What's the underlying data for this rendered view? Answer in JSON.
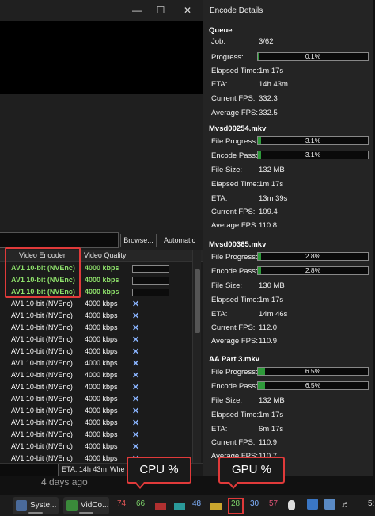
{
  "window": {
    "minimize_glyph": "—",
    "maximize_glyph": "☐",
    "close_glyph": "✕"
  },
  "toolbar": {
    "browse_label": "Browse...",
    "automatic_label": "Automatic"
  },
  "table": {
    "headers": {
      "encoder": "Video Encoder",
      "quality": "Video Quality"
    },
    "rows": [
      {
        "encoder": "AV1 10-bit (NVEnc)",
        "quality": "4000 kbps",
        "state": "active"
      },
      {
        "encoder": "AV1 10-bit (NVEnc)",
        "quality": "4000 kbps",
        "state": "active"
      },
      {
        "encoder": "AV1 10-bit (NVEnc)",
        "quality": "4000 kbps",
        "state": "active"
      },
      {
        "encoder": "AV1 10-bit (NVEnc)",
        "quality": "4000 kbps",
        "state": "queued"
      },
      {
        "encoder": "AV1 10-bit (NVEnc)",
        "quality": "4000 kbps",
        "state": "queued"
      },
      {
        "encoder": "AV1 10-bit (NVEnc)",
        "quality": "4000 kbps",
        "state": "queued"
      },
      {
        "encoder": "AV1 10-bit (NVEnc)",
        "quality": "4000 kbps",
        "state": "queued"
      },
      {
        "encoder": "AV1 10-bit (NVEnc)",
        "quality": "4000 kbps",
        "state": "queued"
      },
      {
        "encoder": "AV1 10-bit (NVEnc)",
        "quality": "4000 kbps",
        "state": "queued"
      },
      {
        "encoder": "AV1 10-bit (NVEnc)",
        "quality": "4000 kbps",
        "state": "queued"
      },
      {
        "encoder": "AV1 10-bit (NVEnc)",
        "quality": "4000 kbps",
        "state": "queued"
      },
      {
        "encoder": "AV1 10-bit (NVEnc)",
        "quality": "4000 kbps",
        "state": "queued"
      },
      {
        "encoder": "AV1 10-bit (NVEnc)",
        "quality": "4000 kbps",
        "state": "queued"
      },
      {
        "encoder": "AV1 10-bit (NVEnc)",
        "quality": "4000 kbps",
        "state": "queued"
      },
      {
        "encoder": "AV1 10-bit (NVEnc)",
        "quality": "4000 kbps",
        "state": "queued"
      },
      {
        "encoder": "AV1 10-bit (NVEnc)",
        "quality": "4000 kbps",
        "state": "queued"
      },
      {
        "encoder": "AV1 10-bit (NVEnc)",
        "quality": "4000 kbps",
        "state": "queued"
      },
      {
        "encoder": "AV1 10-bit (NVEnc)",
        "quality": "4000 kbps",
        "state": "queued"
      }
    ],
    "queued_mark": "✕"
  },
  "status": {
    "eta": "ETA: 14h 43m",
    "truncated": "Whe"
  },
  "days_ago": "4 days ago",
  "panel": {
    "title": "Encode Details",
    "queue": {
      "title": "Queue",
      "job_label": "Job:",
      "job": "3/62",
      "progress_label": "Progress:",
      "progress_text": "0.1%",
      "progress": 0.001,
      "elapsed_label": "Elapsed Time:",
      "elapsed": "1m 17s",
      "eta_label": "ETA:",
      "eta": "14h 43m",
      "fps_label": "Current FPS:",
      "fps": "332.3",
      "avg_label": "Average FPS:",
      "avg": "332.5"
    },
    "jobs": [
      {
        "name": "Mvsd00254.mkv",
        "file_progress_text": "3.1%",
        "file_progress": 0.031,
        "encode_pass_text": "3.1%",
        "encode_pass": 0.031,
        "file_size": "132 MB",
        "elapsed": "1m 17s",
        "eta": "13m 39s",
        "fps": "109.4",
        "avg": "110.8"
      },
      {
        "name": "Mvsd00365.mkv",
        "file_progress_text": "2.8%",
        "file_progress": 0.028,
        "encode_pass_text": "2.8%",
        "encode_pass": 0.028,
        "file_size": "130 MB",
        "elapsed": "1m 17s",
        "eta": "14m 46s",
        "fps": "112.0",
        "avg": "110.9"
      },
      {
        "name": "AA Part 3.mkv",
        "file_progress_text": "6.5%",
        "file_progress": 0.065,
        "encode_pass_text": "6.5%",
        "encode_pass": 0.065,
        "file_size": "132 MB",
        "elapsed": "1m 17s",
        "eta": "6m 17s",
        "fps": "110.9",
        "avg": "110.7"
      }
    ],
    "labels": {
      "file_progress": "File Progress:",
      "encode_pass": "Encode Pass:",
      "file_size": "File Size:",
      "elapsed": "Elapsed Time:",
      "eta": "ETA:",
      "fps": "Current FPS:",
      "avg": "Average FPS:"
    }
  },
  "callouts": {
    "cpu": "CPU %",
    "gpu": "GPU %"
  },
  "taskbar": {
    "app1_label": "Syste...",
    "app2_label": "VidCo...",
    "metrics": [
      {
        "value": "74",
        "color": "#e05555"
      },
      {
        "value": "66",
        "color": "#7fd66b"
      },
      {
        "value": "48",
        "color": "#7fb2ff"
      },
      {
        "value": "28",
        "color": "#7fd66b"
      },
      {
        "value": "30",
        "color": "#7fb2ff"
      },
      {
        "value": "57",
        "color": "#e05577"
      }
    ],
    "clock_truncated": "5:"
  }
}
